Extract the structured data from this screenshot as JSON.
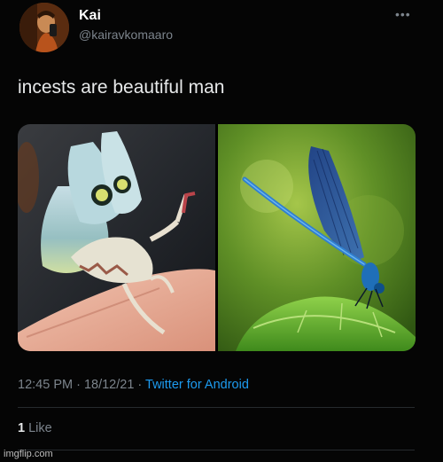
{
  "author": {
    "display_name": "Kai",
    "handle": "@kairavkomaaro"
  },
  "tweet": {
    "text": "incests are beautiful man",
    "more_label": "•••",
    "timestamp": "12:45 PM · 18/12/21 · ",
    "source": "Twitter for Android"
  },
  "engagement": {
    "like_count": "1",
    "like_label": " Like"
  },
  "media": [
    {
      "icon": "orchid-mantis-photo"
    },
    {
      "icon": "damselfly-photo"
    }
  ],
  "watermark": "imgflip.com",
  "colors": {
    "background": "#050505",
    "text": "#e7e9ea",
    "muted": "#7c848c",
    "link": "#1d9bf0"
  }
}
